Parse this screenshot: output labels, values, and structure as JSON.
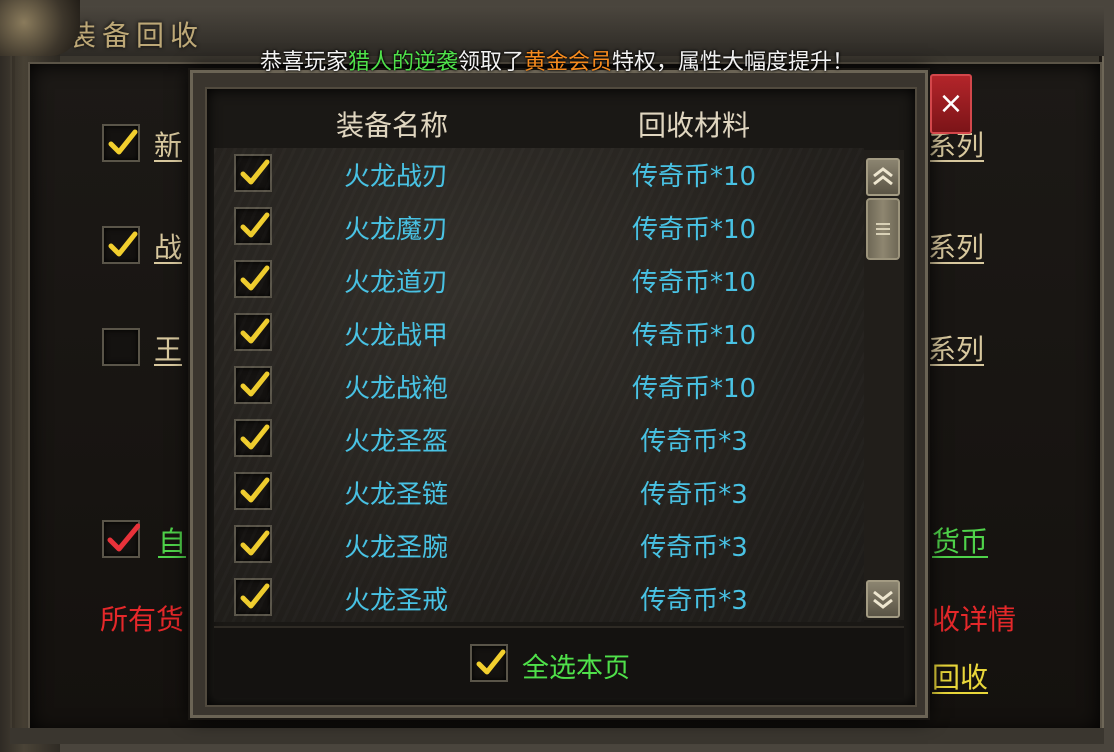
{
  "window": {
    "title": "装备回收"
  },
  "announcement": {
    "prefix": "恭喜玩家",
    "player": "猎人的逆袭",
    "middle": "领取了",
    "vip": "黄金会员",
    "suffix": "特权，属性大幅度提升！"
  },
  "background": {
    "rows": [
      {
        "label_left": "新",
        "label_right": "系列",
        "checked": true
      },
      {
        "label_left": "战",
        "label_right": "系列",
        "checked": true
      },
      {
        "label_left": "王",
        "label_right": "系列",
        "checked": false
      }
    ],
    "auto_label_left": "自",
    "auto_label_right": "货币",
    "all_currency_left": "所有货",
    "details_right": "收详情",
    "recycle_right": "回收"
  },
  "popup": {
    "header_name": "装备名称",
    "header_material": "回收材料",
    "items": [
      {
        "name": "火龙战刃",
        "material": "传奇币*10",
        "checked": true
      },
      {
        "name": "火龙魔刃",
        "material": "传奇币*10",
        "checked": true
      },
      {
        "name": "火龙道刃",
        "material": "传奇币*10",
        "checked": true
      },
      {
        "name": "火龙战甲",
        "material": "传奇币*10",
        "checked": true
      },
      {
        "name": "火龙战袍",
        "material": "传奇币*10",
        "checked": true
      },
      {
        "name": "火龙圣盔",
        "material": "传奇币*3",
        "checked": true
      },
      {
        "name": "火龙圣链",
        "material": "传奇币*3",
        "checked": true
      },
      {
        "name": "火龙圣腕",
        "material": "传奇币*3",
        "checked": true
      },
      {
        "name": "火龙圣戒",
        "material": "传奇币*3",
        "checked": true
      }
    ],
    "select_all_label": "全选本页",
    "close_label": "×"
  },
  "colors": {
    "item_text": "#48c4e6",
    "green": "#4fe04a",
    "vip": "#f58a1e",
    "checkmark": "#f2cf2e",
    "red_checkmark": "#e8323a",
    "close_red": "#b3252a"
  },
  "icons": [
    "check-icon",
    "close-icon",
    "scroll-up-icon",
    "scroll-down-icon",
    "scroll-thumb-grip-icon",
    "dragon-ornament-icon"
  ]
}
